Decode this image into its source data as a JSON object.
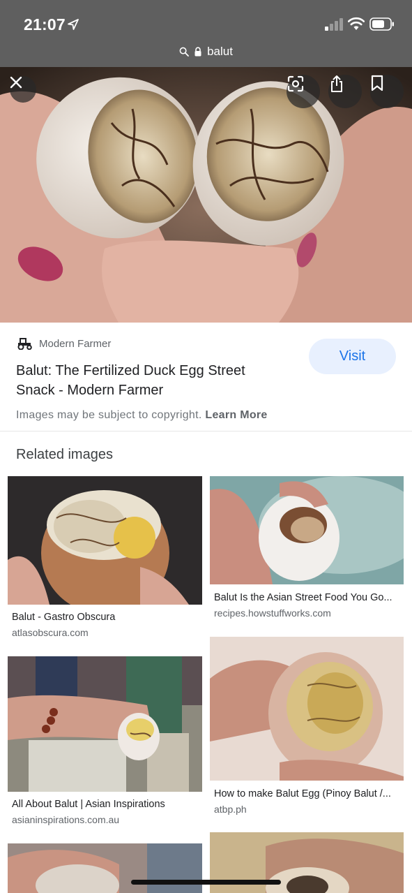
{
  "status_bar": {
    "time": "21:07",
    "icons": [
      "location-arrow-icon",
      "cellular-signal-icon",
      "wifi-icon",
      "battery-icon"
    ]
  },
  "url_bar": {
    "text": "balut",
    "icons": [
      "search-icon",
      "lock-icon"
    ]
  },
  "hero": {
    "buttons": [
      "close-icon",
      "lens-icon",
      "share-icon",
      "bookmark-icon"
    ]
  },
  "source_card": {
    "source_name": "Modern Farmer",
    "source_icon": "tractor-icon",
    "title": "Balut: The Fertilized Duck Egg Street Snack - Modern Farmer",
    "visit_label": "Visit",
    "copyright_text": "Images may be subject to copyright.",
    "learn_more_label": "Learn More"
  },
  "related": {
    "heading": "Related images",
    "items": [
      {
        "caption": "Balut - Gastro Obscura",
        "domain": "atlasobscura.com"
      },
      {
        "caption": "Balut Is the Asian Street Food You Go...",
        "domain": "recipes.howstuffworks.com"
      },
      {
        "caption": "All About Balut | Asian Inspirations",
        "domain": "asianinspirations.com.au"
      },
      {
        "caption": "How to make Balut Egg (Pinoy Balut /...",
        "domain": "atbp.ph"
      }
    ]
  },
  "colors": {
    "top_bar": "#5f5f5f",
    "visit_bg": "#e8f0fe",
    "visit_text": "#1a73e8"
  }
}
